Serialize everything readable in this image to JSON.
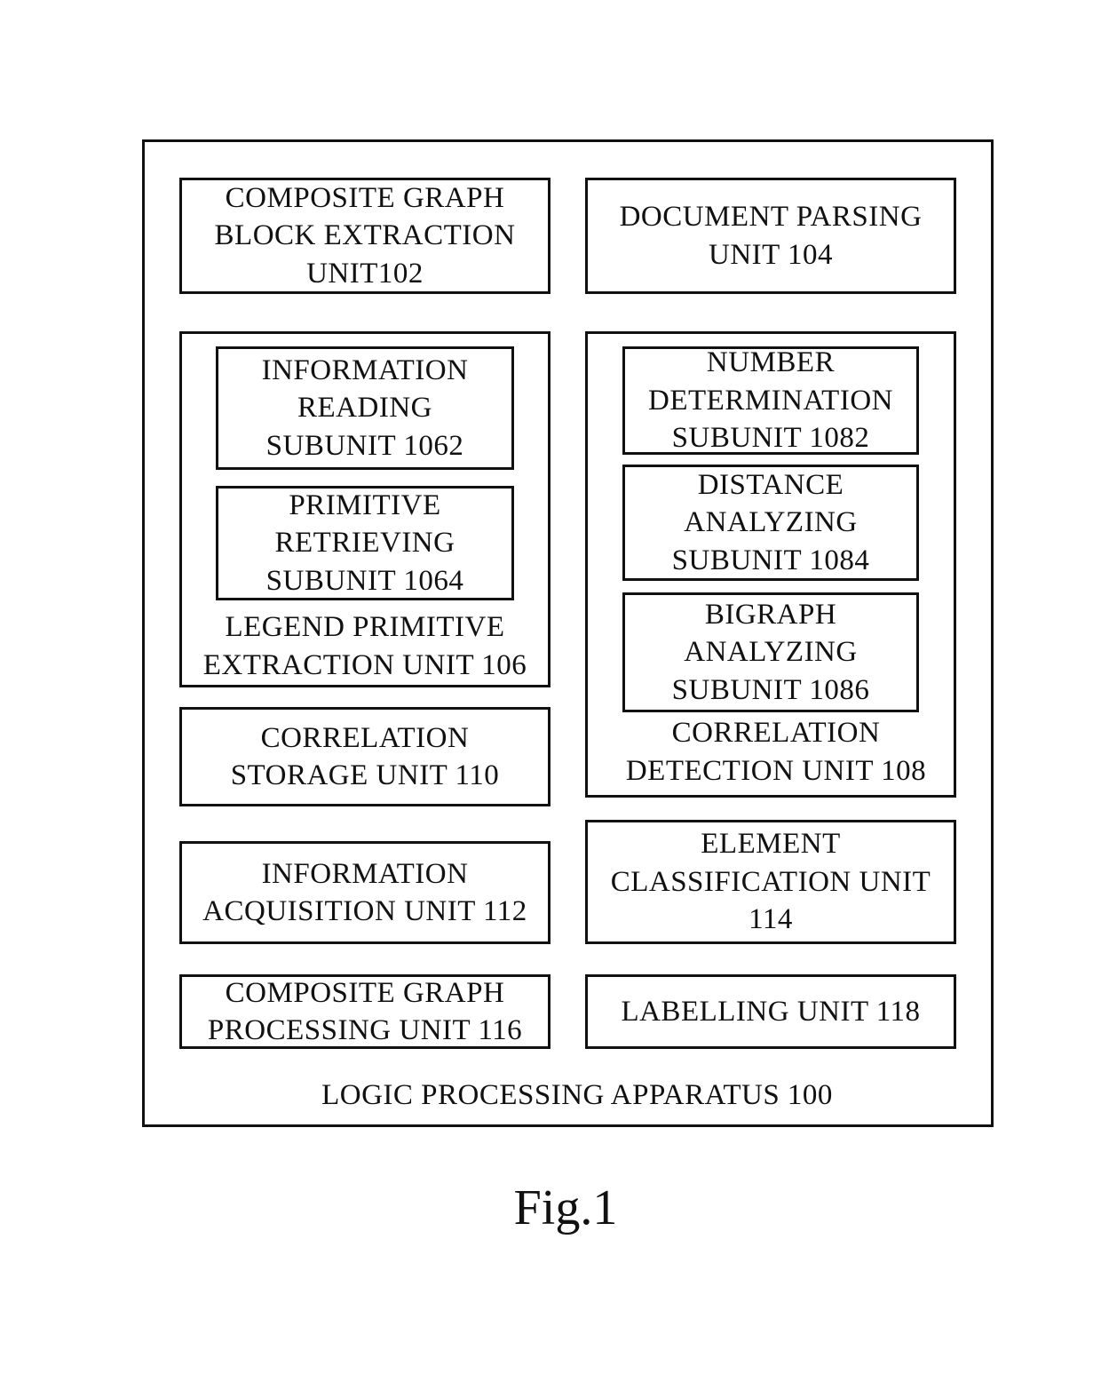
{
  "diagram": {
    "apparatus_caption": "LOGIC PROCESSING APPARATUS 100",
    "figure_label": "Fig.1",
    "units": {
      "composite_graph_block_extraction": "COMPOSITE GRAPH\nBLOCK EXTRACTION\nUNIT102",
      "document_parsing": "DOCUMENT PARSING\nUNIT 104",
      "legend_primitive_extraction": {
        "label": "LEGEND PRIMITIVE\nEXTRACTION UNIT 106",
        "subunits": {
          "information_reading": "INFORMATION\nREADING\nSUBUNIT 1062",
          "primitive_retrieving": "PRIMITIVE\nRETRIEVING\nSUBUNIT 1064"
        }
      },
      "correlation_detection": {
        "label": "CORRELATION\nDETECTION UNIT 108",
        "subunits": {
          "number_determination": "NUMBER\nDETERMINATION\nSUBUNIT 1082",
          "distance_analyzing": "DISTANCE\nANALYZING\nSUBUNIT 1084",
          "bigraph_analyzing": "BIGRAPH\nANALYZING\nSUBUNIT 1086"
        }
      },
      "correlation_storage": "CORRELATION\nSTORAGE UNIT 110",
      "information_acquisition": "INFORMATION\nACQUISITION UNIT 112",
      "element_classification": "ELEMENT\nCLASSIFICATION UNIT\n114",
      "composite_graph_processing": "COMPOSITE GRAPH\nPROCESSING UNIT 116",
      "labelling": "LABELLING UNIT 118"
    }
  }
}
